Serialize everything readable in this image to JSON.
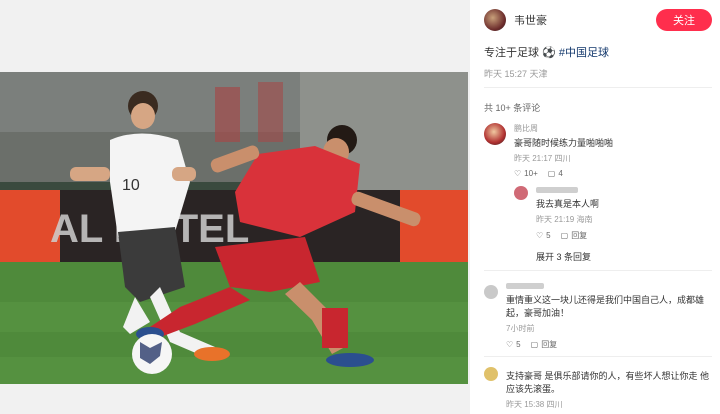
{
  "post": {
    "author": "韦世豪",
    "follow_label": "关注",
    "text": "专注于足球",
    "tag": "#中国足球",
    "meta": "昨天 15:27 天津",
    "comment_count": "共 10+ 条评论"
  },
  "comments": [
    {
      "name": "鹏比周",
      "text": "豪哥随时候练力量啪啪啪",
      "meta": "昨天 21:17 四川",
      "likes": "10+",
      "replies": "4",
      "reply_label": "回复"
    },
    {
      "name": "",
      "text": "我去真是本人啊",
      "meta": "昨天 21:19 海南",
      "likes": "5",
      "reply_label": "回复",
      "is_reply": true
    },
    {
      "expand_label": "展开 3 条回复"
    },
    {
      "name": "",
      "text": "重情重义这一块儿还得是我们中国自己人，成都雄起，豪哥加油！",
      "meta": "7小时前",
      "likes": "5",
      "reply_label": "回复"
    },
    {
      "name": "支持豪哥",
      "text": "是俱乐部请你的人，有些坏人想让你走 他应该先滚蛋。",
      "meta": "昨天 15:38 四川"
    }
  ],
  "colors": {
    "follow_button": "#ff2e4d",
    "tag": "#13386c"
  },
  "icons": [
    "heart-icon",
    "comment-icon",
    "football-icon"
  ]
}
